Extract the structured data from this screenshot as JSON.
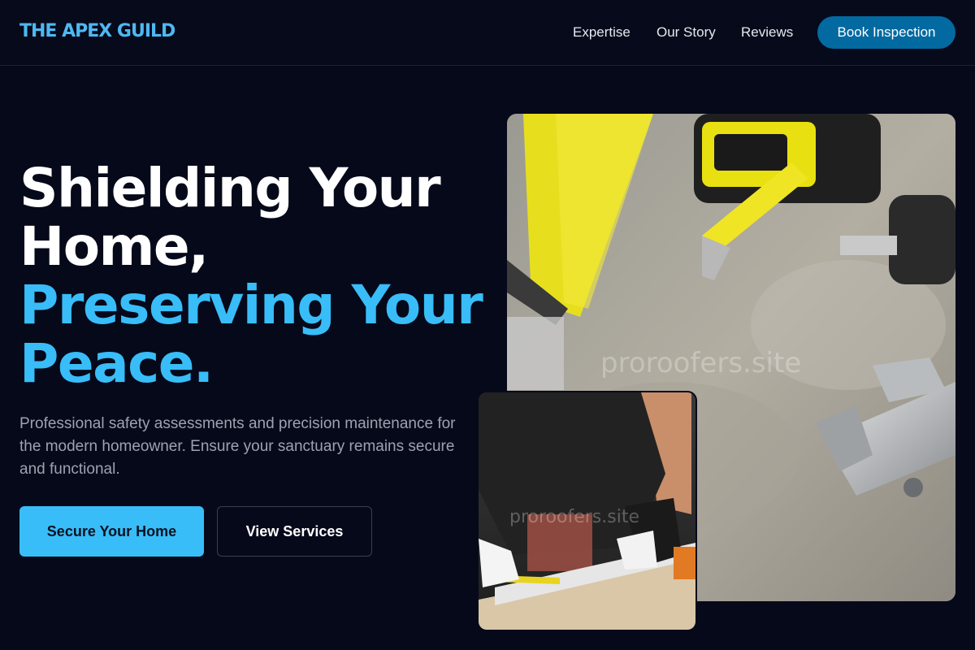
{
  "header": {
    "logo": "THE APEX GUILD",
    "nav": [
      "Expertise",
      "Our Story",
      "Reviews"
    ],
    "cta": "Book Inspection"
  },
  "hero": {
    "headline_white": [
      "Shielding Your",
      "Home,"
    ],
    "headline_blue": [
      "Preserving Your",
      "Peace."
    ],
    "subtitle": "Professional safety assessments and precision maintenance for the modern homeowner. Ensure your sanctuary remains secure and functional.",
    "primary_button": "Secure Your Home",
    "secondary_button": "View Services"
  },
  "images": {
    "main_watermark": "proroofers.site",
    "small_watermark": "proroofers.site",
    "main_alt": "tools-on-concrete-photo",
    "small_alt": "worker-measuring-photo"
  },
  "colors": {
    "background": "#06091a",
    "accent": "#38bdf8",
    "cta_button": "#0369a1"
  }
}
